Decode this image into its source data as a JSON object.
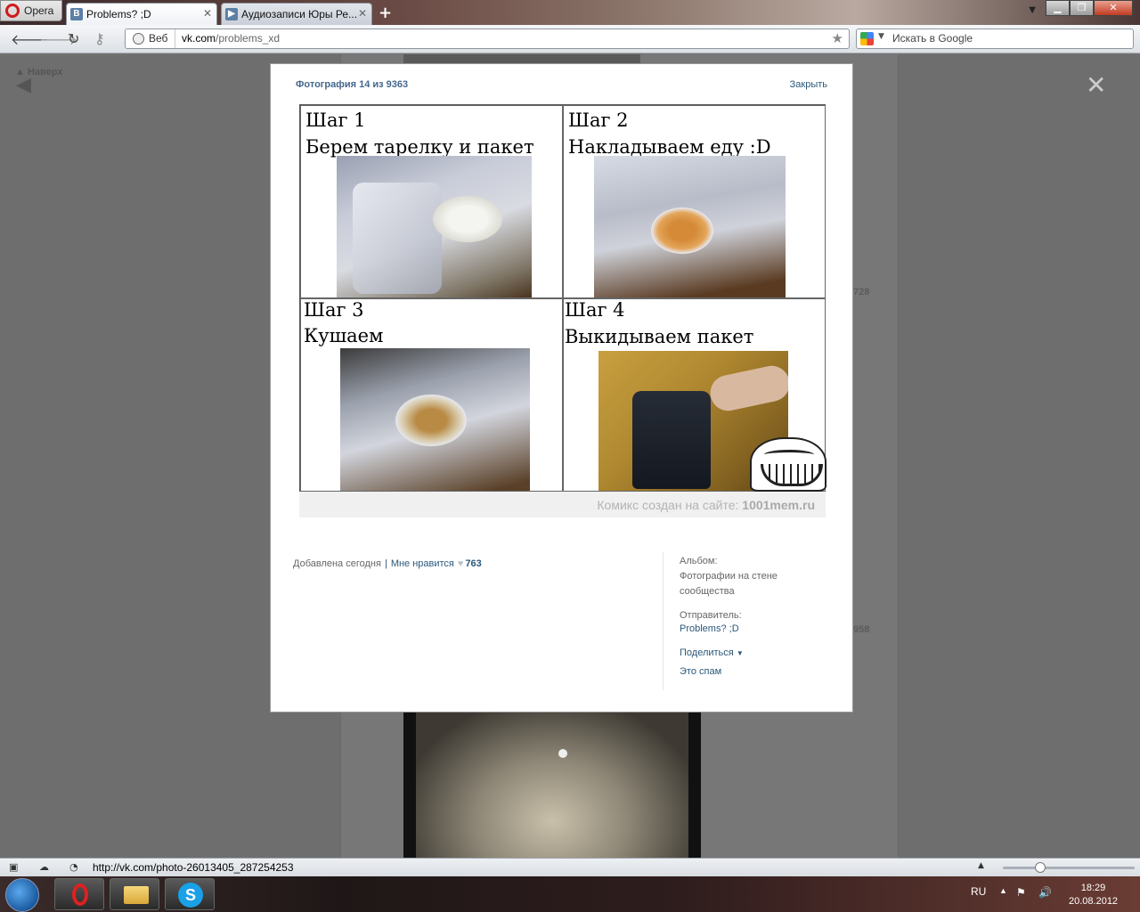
{
  "browser": {
    "menu_label": "Opera",
    "tabs": [
      {
        "label": "Problems? ;D",
        "icon": "vk-icon"
      },
      {
        "label": "Аудиозаписи Юры Ре...",
        "icon": "vk-audio-icon"
      }
    ],
    "address": {
      "scheme_label": "Веб",
      "domain": "vk.com",
      "path": "/problems_xd"
    },
    "search_placeholder": "Искать в Google"
  },
  "page": {
    "up_link": "Наверх",
    "bg_numbers": [
      "728",
      "958"
    ]
  },
  "viewer": {
    "title": "Фотография 14 из 9363",
    "close_label": "Закрыть",
    "comic": {
      "steps": [
        {
          "title": "Шаг 1",
          "text": "Берем тарелку и пакет"
        },
        {
          "title": "Шаг 2",
          "text": "Накладываем еду :D"
        },
        {
          "title": "Шаг 3",
          "text": "Кушаем"
        },
        {
          "title": "Шаг 4",
          "text": "Выкидываем пакет"
        }
      ],
      "footer_text": "Комикс создан на сайте:",
      "footer_site": "1001mem.ru"
    },
    "added": "Добавлена сегодня",
    "like_label": "Мне нравится",
    "like_count": "763",
    "album_label": "Альбом:",
    "album_name_1": "Фотографии на стене",
    "album_name_2": "сообщества",
    "sender_label": "Отправитель:",
    "sender_name": "Problems? ;D",
    "share_label": "Поделиться",
    "spam_label": "Это спам"
  },
  "statusbar": {
    "url": "http://vk.com/photo-26013405_287254253"
  },
  "taskbar": {
    "lang": "RU",
    "time": "18:29",
    "date": "20.08.2012"
  }
}
